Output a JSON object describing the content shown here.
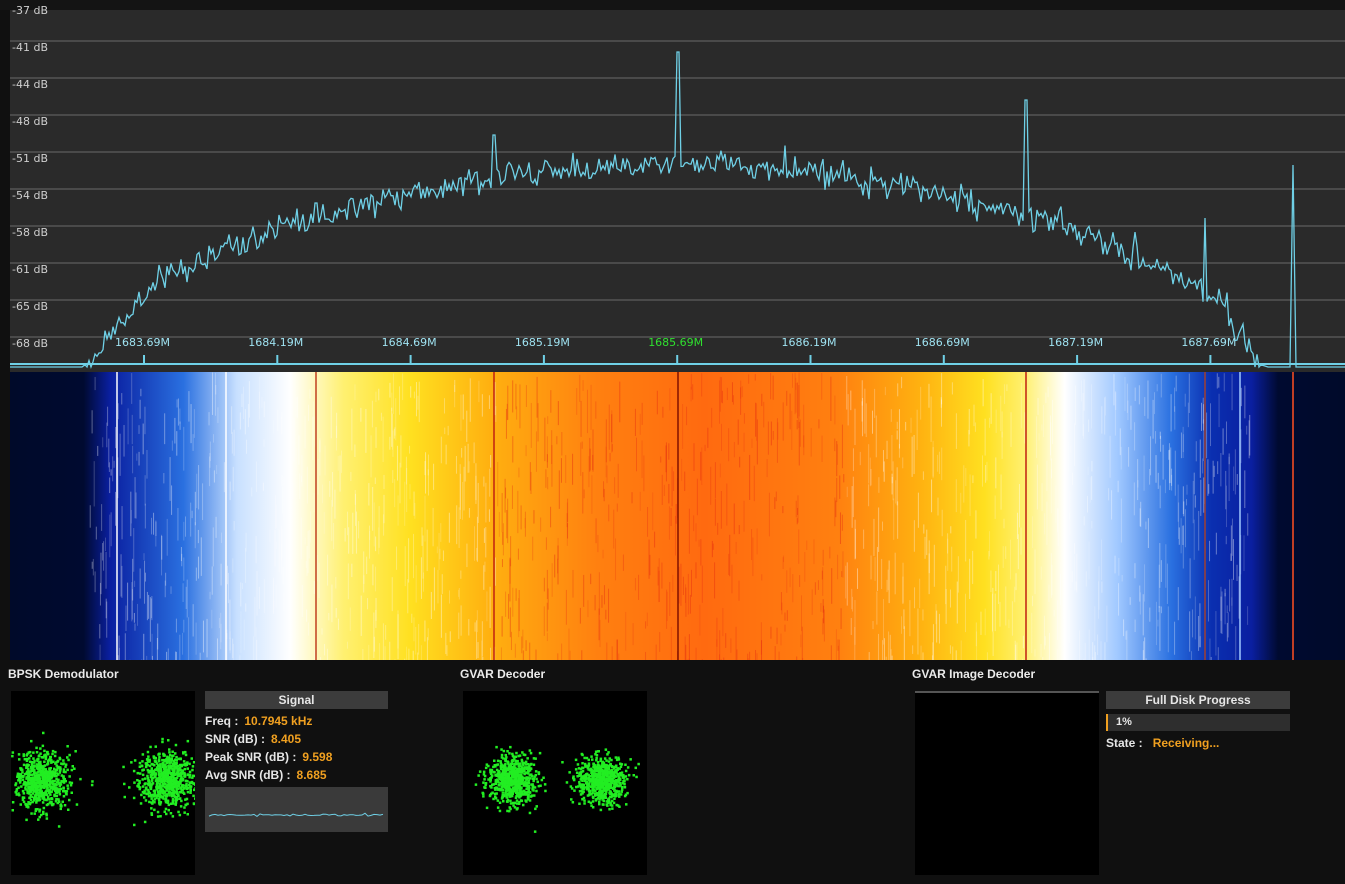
{
  "spectrum": {
    "db_labels": [
      "-37 dB",
      "-41 dB",
      "-44 dB",
      "-48 dB",
      "-51 dB",
      "-54 dB",
      "-58 dB",
      "-61 dB",
      "-65 dB",
      "-68 dB"
    ],
    "freq_labels": [
      "1683.69M",
      "1684.19M",
      "1684.69M",
      "1685.19M",
      "1685.69M",
      "1686.19M",
      "1686.69M",
      "1687.19M",
      "1687.69M"
    ],
    "center_freq": "1685.69M",
    "colors": {
      "trace": "#6fd0e6",
      "center": "#2fe02f",
      "grid": "#6a6a6a",
      "background": "#2a2a2a"
    }
  },
  "waterfall": {
    "colormap": [
      "#000a2a",
      "#0a1fa0",
      "#2a70e0",
      "#ffffff",
      "#ffe020",
      "#ffa010",
      "#ff6a10"
    ]
  },
  "bpsk_demodulator": {
    "title": "BPSK Demodulator",
    "signal_header": "Signal",
    "freq_label": "Freq :",
    "freq_value": "10.7945 kHz",
    "snr_label": "SNR (dB) :",
    "snr_value": "8.405",
    "peak_snr_label": "Peak SNR (dB) :",
    "peak_snr_value": "9.598",
    "avg_snr_label": "Avg SNR (dB) :",
    "avg_snr_value": "8.685"
  },
  "gvar_decoder": {
    "title": "GVAR Decoder"
  },
  "gvar_image_decoder": {
    "title": "GVAR Image Decoder",
    "progress_header": "Full Disk Progress",
    "progress_text": "1%",
    "progress_fraction": 0.01,
    "state_label": "State :",
    "state_value": "Receiving..."
  }
}
